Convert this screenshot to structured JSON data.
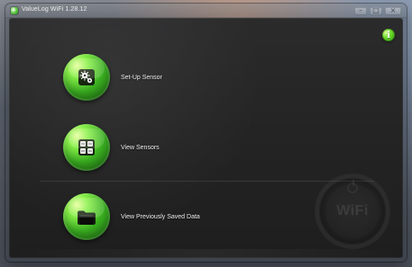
{
  "window": {
    "title": "ValueLog WiFi 1.28.12",
    "controls": {
      "minimize_glyph": "–",
      "maximize_glyph": "□",
      "close_glyph": "×"
    }
  },
  "header": {
    "info_icon": "i"
  },
  "menu": {
    "items": [
      {
        "label": "Set-Up Sensor",
        "icon": "gear-sensor-icon"
      },
      {
        "label": "View Sensors",
        "icon": "sensors-grid-icon"
      },
      {
        "label": "View Previously Saved Data",
        "icon": "folder-icon"
      }
    ]
  },
  "branding": {
    "watermark_text": "WiFi"
  },
  "colors": {
    "accent_green": "#3bb021",
    "background_dark": "#232323"
  }
}
